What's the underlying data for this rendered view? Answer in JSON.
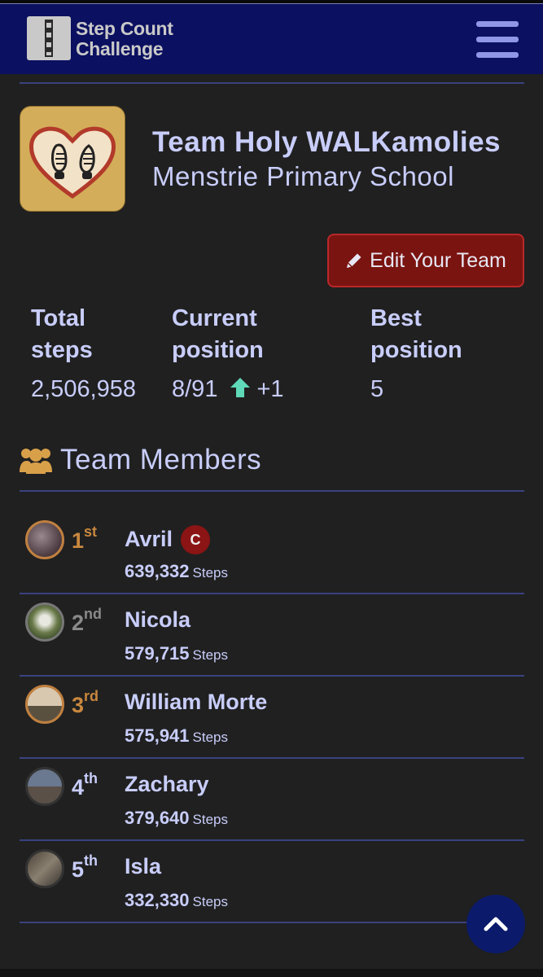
{
  "app": {
    "brand_line1": "Step Count",
    "brand_line2": "Challenge",
    "logo_icon": "footsteps-logo-icon",
    "menu_icon": "hamburger-menu-icon"
  },
  "team": {
    "name": "Team Holy WALKamolies",
    "school": "Menstrie Primary School",
    "logo_icon": "heart-footprints-icon",
    "edit_button_label": "Edit Your Team",
    "edit_icon": "pencil-icon"
  },
  "stats": {
    "total_steps_label_1": "Total",
    "total_steps_label_2": "steps",
    "total_steps_value": "2,506,958",
    "current_position_label_1": "Current",
    "current_position_label_2": "position",
    "current_position_value": "8/91",
    "position_change": "+1",
    "position_change_icon": "arrow-up-icon",
    "best_position_label_1": "Best",
    "best_position_label_2": "position",
    "best_position_value": "5"
  },
  "members_section": {
    "title": "Team Members",
    "icon": "users-icon"
  },
  "members": [
    {
      "rank_num": "1",
      "rank_suffix": "st",
      "name": "Avril",
      "captain_badge": "C",
      "steps": "639,332",
      "unit": "Steps",
      "rank_color": "#c9883e"
    },
    {
      "rank_num": "2",
      "rank_suffix": "nd",
      "name": "Nicola",
      "captain_badge": "",
      "steps": "579,715",
      "unit": "Steps",
      "rank_color": "#8a8a8a"
    },
    {
      "rank_num": "3",
      "rank_suffix": "rd",
      "name": "William Morte",
      "captain_badge": "",
      "steps": "575,941",
      "unit": "Steps",
      "rank_color": "#c9883e"
    },
    {
      "rank_num": "4",
      "rank_suffix": "th",
      "name": "Zachary",
      "captain_badge": "",
      "steps": "379,640",
      "unit": "Steps",
      "rank_color": "#c8cdfa"
    },
    {
      "rank_num": "5",
      "rank_suffix": "th",
      "name": "Isla",
      "captain_badge": "",
      "steps": "332,330",
      "unit": "Steps",
      "rank_color": "#c8cdfa"
    }
  ],
  "scroll_top_icon": "chevron-up-icon",
  "colors": {
    "navbar": "#0b1060",
    "background": "#202020",
    "text": "#c8cdfa",
    "edit_button": "#7a1410",
    "gold": "#c9883e",
    "arrow_up": "#5fd9b8"
  }
}
